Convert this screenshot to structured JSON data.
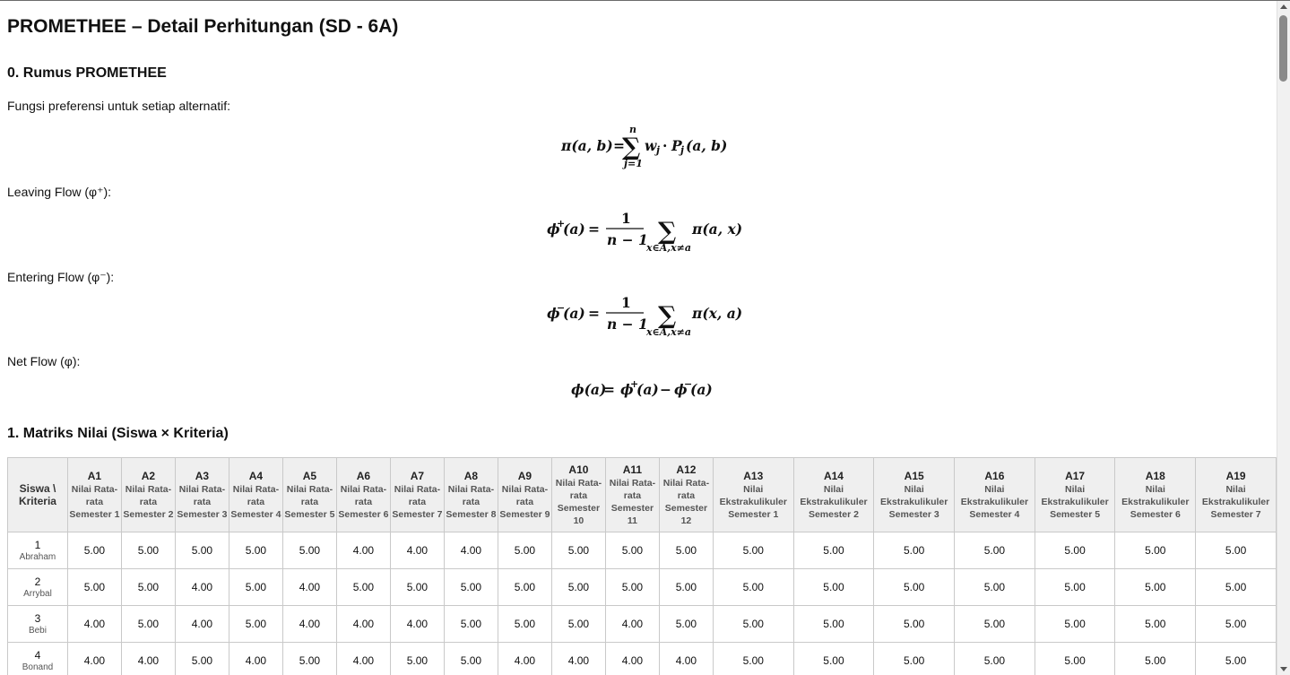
{
  "page": {
    "title": "PROMETHEE – Detail Perhitungan (SD - 6A)"
  },
  "section0": {
    "heading": "0. Rumus PROMETHEE",
    "preference_label": "Fungsi preferensi untuk setiap alternatif:",
    "preference_formula": "π(a,b) = Σ_{j=1}^{n} w_j · P_j(a,b)",
    "leaving_label": "Leaving Flow (φ⁺):",
    "leaving_formula": "φ⁺(a) = 1/(n−1) Σ_{x∈A,x≠a} π(a,x)",
    "entering_label": "Entering Flow (φ⁻):",
    "entering_formula": "φ⁻(a) = 1/(n−1) Σ_{x∈A,x≠a} π(x,a)",
    "net_label": "Net Flow (φ):",
    "net_formula": "φ(a) = φ⁺(a) − φ⁻(a)"
  },
  "section1": {
    "heading": "1. Matriks Nilai (Siswa × Kriteria)",
    "corner_header": "Siswa \\ Kriteria",
    "columns": [
      {
        "code": "A1",
        "label": "Nilai Rata-rata Semester 1"
      },
      {
        "code": "A2",
        "label": "Nilai Rata-rata Semester 2"
      },
      {
        "code": "A3",
        "label": "Nilai Rata-rata Semester 3"
      },
      {
        "code": "A4",
        "label": "Nilai Rata-rata Semester 4"
      },
      {
        "code": "A5",
        "label": "Nilai Rata-rata Semester 5"
      },
      {
        "code": "A6",
        "label": "Nilai Rata-rata Semester 6"
      },
      {
        "code": "A7",
        "label": "Nilai Rata-rata Semester 7"
      },
      {
        "code": "A8",
        "label": "Nilai Rata-rata Semester 8"
      },
      {
        "code": "A9",
        "label": "Nilai Rata-rata Semester 9"
      },
      {
        "code": "A10",
        "label": "Nilai Rata-rata Semester 10"
      },
      {
        "code": "A11",
        "label": "Nilai Rata-rata Semester 11"
      },
      {
        "code": "A12",
        "label": "Nilai Rata-rata Semester 12"
      },
      {
        "code": "A13",
        "label": "Nilai Ekstrakulikuler Semester 1"
      },
      {
        "code": "A14",
        "label": "Nilai Ekstrakulikuler Semester 2"
      },
      {
        "code": "A15",
        "label": "Nilai Ekstrakulikuler Semester 3"
      },
      {
        "code": "A16",
        "label": "Nilai Ekstrakulikuler Semester 4"
      },
      {
        "code": "A17",
        "label": "Nilai Ekstrakulikuler Semester 5"
      },
      {
        "code": "A18",
        "label": "Nilai Ekstrakulikuler Semester 6"
      },
      {
        "code": "A19",
        "label": "Nilai Ekstrakulikuler Semester 7"
      }
    ],
    "rows": [
      {
        "no": "1",
        "name": "Abraham",
        "values": [
          "5.00",
          "5.00",
          "5.00",
          "5.00",
          "5.00",
          "4.00",
          "4.00",
          "4.00",
          "5.00",
          "5.00",
          "5.00",
          "5.00",
          "5.00",
          "5.00",
          "5.00",
          "5.00",
          "5.00",
          "5.00",
          "5.00"
        ]
      },
      {
        "no": "2",
        "name": "Arrybal",
        "values": [
          "5.00",
          "5.00",
          "4.00",
          "5.00",
          "4.00",
          "5.00",
          "5.00",
          "5.00",
          "5.00",
          "5.00",
          "5.00",
          "5.00",
          "5.00",
          "5.00",
          "5.00",
          "5.00",
          "5.00",
          "5.00",
          "5.00"
        ]
      },
      {
        "no": "3",
        "name": "Bebi",
        "values": [
          "4.00",
          "5.00",
          "4.00",
          "5.00",
          "4.00",
          "4.00",
          "4.00",
          "5.00",
          "5.00",
          "5.00",
          "4.00",
          "5.00",
          "5.00",
          "5.00",
          "5.00",
          "5.00",
          "5.00",
          "5.00",
          "5.00"
        ]
      },
      {
        "no": "4",
        "name": "Bonand",
        "values": [
          "4.00",
          "4.00",
          "5.00",
          "4.00",
          "5.00",
          "4.00",
          "5.00",
          "5.00",
          "4.00",
          "4.00",
          "4.00",
          "4.00",
          "5.00",
          "5.00",
          "5.00",
          "5.00",
          "5.00",
          "5.00",
          "5.00"
        ]
      }
    ]
  }
}
